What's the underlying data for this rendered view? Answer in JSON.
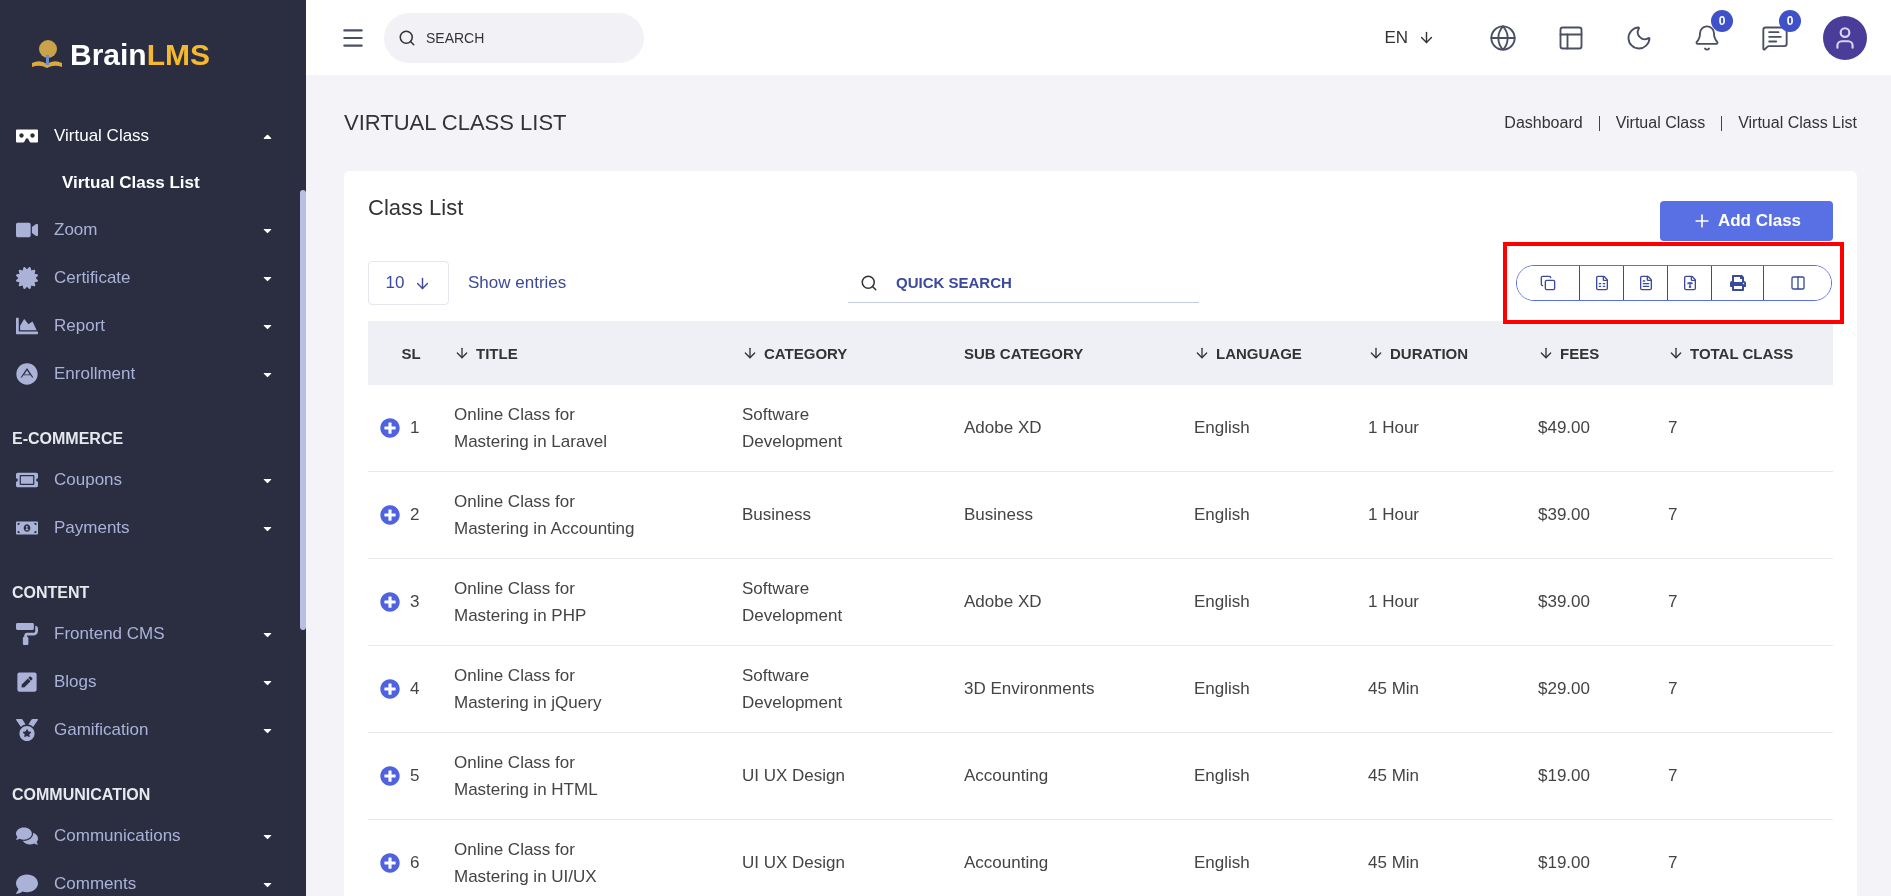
{
  "logo": {
    "name": "Brain",
    "accent": "LMS"
  },
  "sidebar": {
    "sections": [
      {
        "items": [
          {
            "label": "Virtual Class",
            "expanded": true,
            "selected": false,
            "children": [
              {
                "label": "Virtual Class List",
                "selected": true
              }
            ]
          },
          {
            "label": "Zoom",
            "expanded": false,
            "selected": false
          },
          {
            "label": "Certificate",
            "expanded": false,
            "selected": false
          },
          {
            "label": "Report",
            "expanded": false,
            "selected": false
          },
          {
            "label": "Enrollment",
            "expanded": false,
            "selected": false
          }
        ]
      },
      {
        "heading": "E-COMMERCE",
        "items": [
          {
            "label": "Coupons",
            "expanded": false,
            "selected": false
          },
          {
            "label": "Payments",
            "expanded": false,
            "selected": false
          }
        ]
      },
      {
        "heading": "CONTENT",
        "items": [
          {
            "label": "Frontend CMS",
            "expanded": false,
            "selected": false
          },
          {
            "label": "Blogs",
            "expanded": false,
            "selected": false
          },
          {
            "label": "Gamification",
            "expanded": false,
            "selected": false
          }
        ]
      },
      {
        "heading": "COMMUNICATION",
        "items": [
          {
            "label": "Communications",
            "expanded": false,
            "selected": false
          },
          {
            "label": "Comments",
            "expanded": false,
            "selected": false
          }
        ]
      }
    ]
  },
  "topbar": {
    "search": {
      "placeholder": "SEARCH"
    },
    "language": "EN",
    "notifications": "0",
    "messages": "0"
  },
  "page_title": "VIRTUAL CLASS LIST",
  "breadcrumbs": [
    "Dashboard",
    "Virtual Class",
    "Virtual Class List"
  ],
  "card": {
    "title": "Class List",
    "add_button": "Add Class",
    "entries": "10",
    "entries_label": "Show entries",
    "quick_search": {
      "placeholder": "QUICK SEARCH"
    }
  },
  "table": {
    "columns": [
      {
        "label": "SL",
        "sortable": false
      },
      {
        "label": "TITLE",
        "sortable": true
      },
      {
        "label": "CATEGORY",
        "sortable": true
      },
      {
        "label": "SUB CATEGORY",
        "sortable": false
      },
      {
        "label": "LANGUAGE",
        "sortable": true
      },
      {
        "label": "DURATION",
        "sortable": true
      },
      {
        "label": "FEES",
        "sortable": true
      },
      {
        "label": "TOTAL CLASS",
        "sortable": true
      }
    ],
    "rows": [
      [
        "1",
        "Online Class for Mastering in Laravel",
        "Software Development",
        "Adobe XD",
        "English",
        "1 Hour",
        "$49.00",
        "7"
      ],
      [
        "2",
        "Online Class for Mastering in Accounting",
        "Business",
        "Business",
        "English",
        "1 Hour",
        "$39.00",
        "7"
      ],
      [
        "3",
        "Online Class for Mastering in PHP",
        "Software Development",
        "Adobe XD",
        "English",
        "1 Hour",
        "$39.00",
        "7"
      ],
      [
        "4",
        "Online Class for Mastering in jQuery",
        "Software Development",
        "3D Environments",
        "English",
        "45 Min",
        "$29.00",
        "7"
      ],
      [
        "5",
        "Online Class for Mastering in HTML",
        "UI UX Design",
        "Accounting",
        "English",
        "45 Min",
        "$19.00",
        "7"
      ],
      [
        "6",
        "Online Class for Mastering in UI/UX",
        "UI UX Design",
        "Accounting",
        "English",
        "45 Min",
        "$19.00",
        "7"
      ]
    ]
  }
}
